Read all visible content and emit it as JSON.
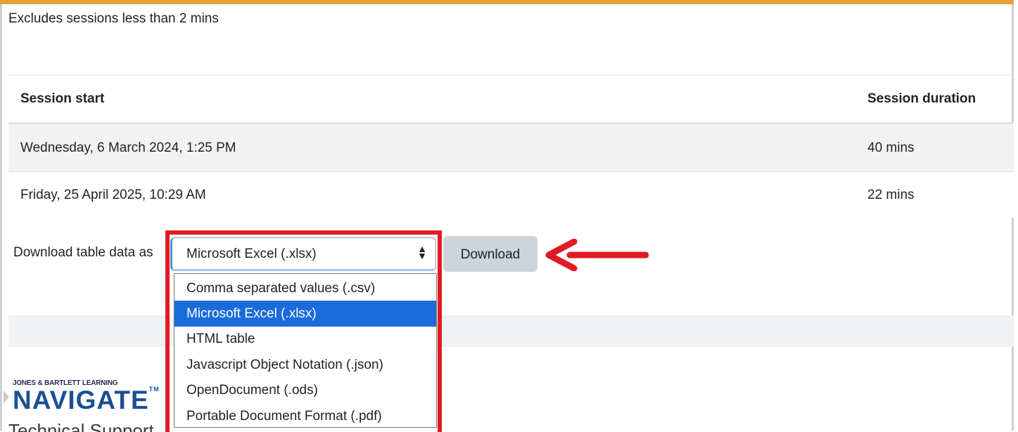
{
  "note": "Excludes sessions less than 2 mins",
  "table": {
    "headers": [
      "Session start",
      "Session duration"
    ],
    "rows": [
      [
        "Wednesday, 6 March 2024, 1:25 PM",
        "40 mins"
      ],
      [
        "Friday, 25 April 2025, 10:29 AM",
        "22 mins"
      ]
    ]
  },
  "download": {
    "label": "Download table data as",
    "selected": "Microsoft Excel (.xlsx)",
    "button": "Download",
    "options": [
      "Comma separated values (.csv)",
      "Microsoft Excel (.xlsx)",
      "HTML table",
      "Javascript Object Notation (.json)",
      "OpenDocument (.ods)",
      "Portable Document Format (.pdf)"
    ],
    "selected_index": 1
  },
  "footer": {
    "logo_top": "JONES & BARTLETT LEARNING",
    "logo_main": "NAVIGATE",
    "logo_tm": "TM",
    "tech_support": "Technical Support"
  },
  "colors": {
    "highlight": "#e11b22",
    "selected_option": "#1a6bdb",
    "top_strip": "#e8a13a"
  },
  "icons": {
    "select_arrows": "sort-arrows-icon",
    "annotation": "left-arrow-icon"
  }
}
